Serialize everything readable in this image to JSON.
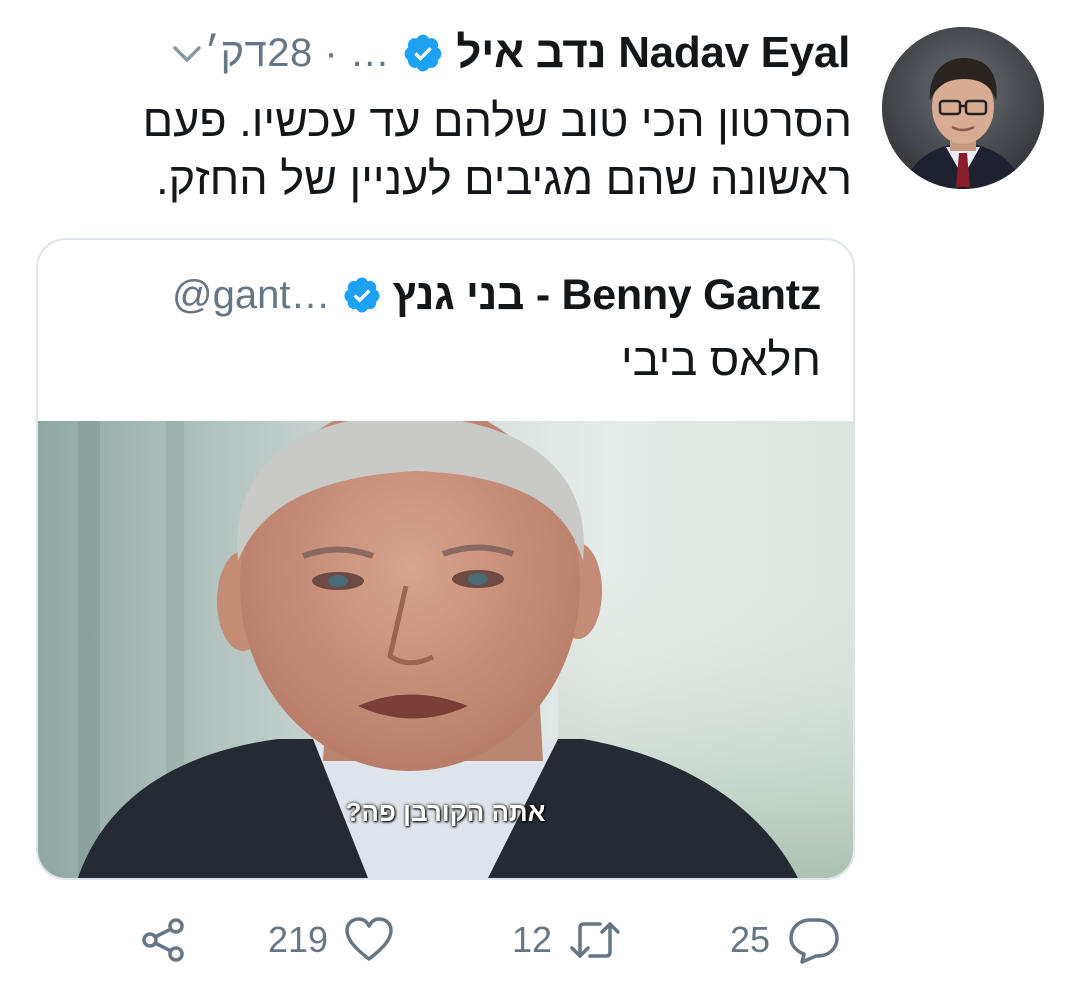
{
  "tweet": {
    "display_name": "נדב איל Nadav Eyal",
    "meta": "‏… · 28דק׳",
    "text": "הסרטון הכי טוב שלהם עד עכשיו. פעם ראשונה שהם מגיבים לעניין של החזק.",
    "avatar_icon": "user-avatar"
  },
  "quoted": {
    "display_name": "בני גנץ - Benny Gantz",
    "handle": "@gant…",
    "text": "חלאס ביבי",
    "subtitle": "אתה הקורבן פה?"
  },
  "actions": {
    "share_icon": "share-icon",
    "likes": "219",
    "retweets": "12",
    "replies": "25"
  },
  "colors": {
    "verified": "#1da1f2",
    "secondary_text": "#657786",
    "border": "#dfe5ea"
  }
}
